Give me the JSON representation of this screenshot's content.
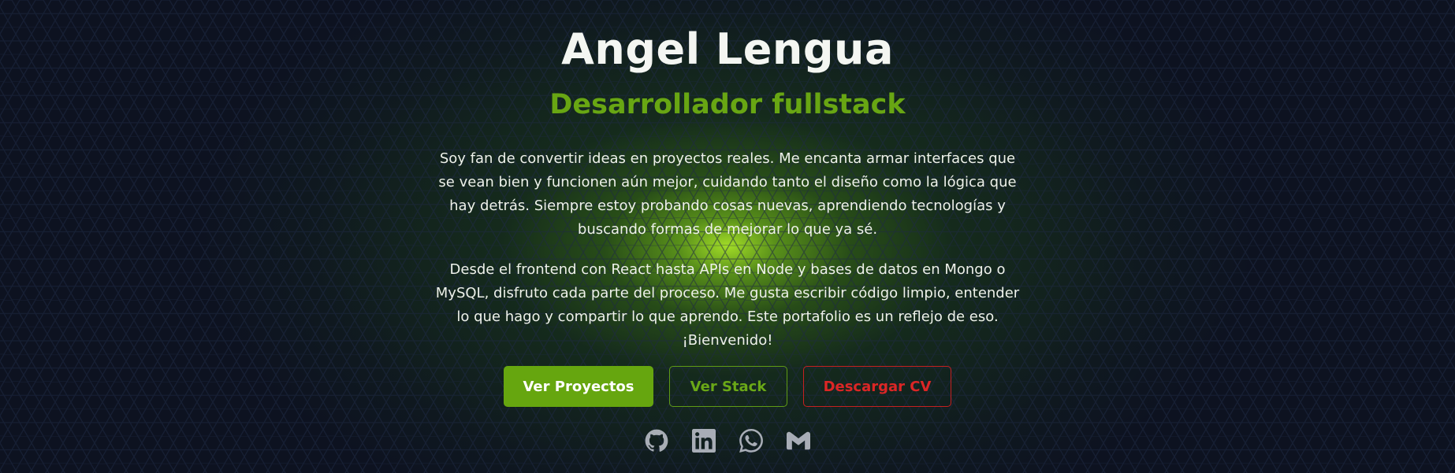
{
  "header": {
    "name": "Angel Lengua",
    "role": "Desarrollador fullstack"
  },
  "about": {
    "paragraph_1": "Soy fan de convertir ideas en proyectos reales. Me encanta armar interfaces que se vean bien y funcionen aún mejor, cuidando tanto el diseño como la lógica que hay detrás. Siempre estoy probando cosas nuevas, aprendiendo tecnologías y buscando formas de mejorar lo que ya sé.",
    "paragraph_2": "Desde el frontend con React hasta APIs en Node y bases de datos en Mongo o MySQL, disfruto cada parte del proceso. Me gusta escribir código limpio, entender lo que hago y compartir lo que aprendo. Este portafolio es un reflejo de eso. ¡Bienvenido!"
  },
  "actions": {
    "projects_label": "Ver Proyectos",
    "stack_label": "Ver Stack",
    "cv_label": "Descargar CV"
  },
  "socials": [
    {
      "icon": "github-icon"
    },
    {
      "icon": "linkedin-icon"
    },
    {
      "icon": "whatsapp-icon"
    },
    {
      "icon": "gmail-icon"
    }
  ],
  "colors": {
    "accent": "#66a60f",
    "danger": "#dc2626",
    "background": "#0d1220",
    "text": "#f4f6f2"
  }
}
